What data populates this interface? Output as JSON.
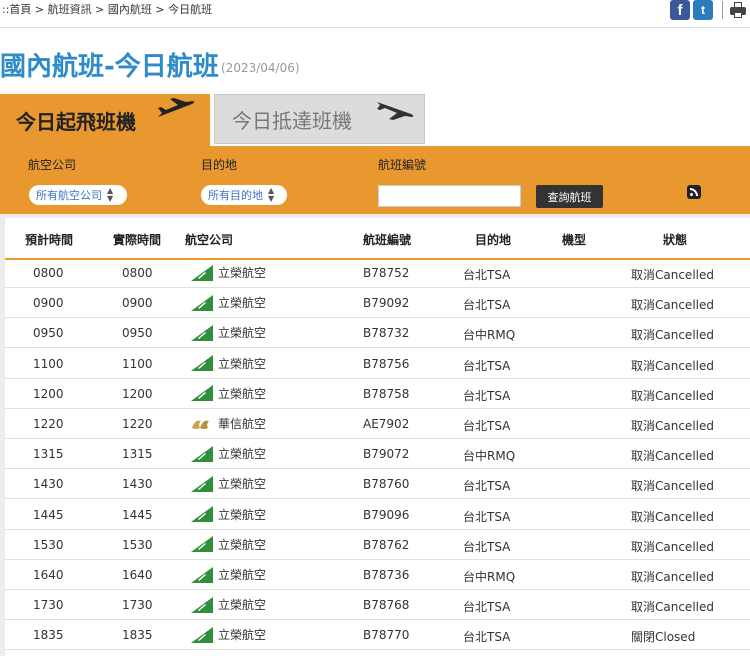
{
  "breadcrumb": {
    "prefix": "::",
    "items": [
      "首頁",
      "航班資訊",
      "國內航班",
      "今日航班"
    ],
    "separator": " > "
  },
  "social": {
    "facebook": "f",
    "twitter": "t"
  },
  "page": {
    "title": "國內航班-今日航班",
    "date": "(2023/04/06)"
  },
  "tabs": {
    "departures": "今日起飛班機",
    "arrivals": "今日抵達班機"
  },
  "filters": {
    "airline_label": "航空公司",
    "airline_value": "所有航空公司",
    "destination_label": "目的地",
    "destination_value": "所有目的地",
    "flight_no_label": "航班編號",
    "flight_no_value": "",
    "search_button": "查詢航班"
  },
  "table": {
    "headers": [
      "預計時間",
      "實際時間",
      "航空公司",
      "航班編號",
      "目的地",
      "機型",
      "狀態"
    ],
    "rows": [
      {
        "scheduled": "0800",
        "actual": "0800",
        "airline": "立榮航空",
        "logo": "uni",
        "flight": "B78752",
        "destination": "台北TSA",
        "aircraft": "",
        "status": "取消Cancelled"
      },
      {
        "scheduled": "0900",
        "actual": "0900",
        "airline": "立榮航空",
        "logo": "uni",
        "flight": "B79092",
        "destination": "台北TSA",
        "aircraft": "",
        "status": "取消Cancelled"
      },
      {
        "scheduled": "0950",
        "actual": "0950",
        "airline": "立榮航空",
        "logo": "uni",
        "flight": "B78732",
        "destination": "台中RMQ",
        "aircraft": "",
        "status": "取消Cancelled"
      },
      {
        "scheduled": "1100",
        "actual": "1100",
        "airline": "立榮航空",
        "logo": "uni",
        "flight": "B78756",
        "destination": "台北TSA",
        "aircraft": "",
        "status": "取消Cancelled"
      },
      {
        "scheduled": "1200",
        "actual": "1200",
        "airline": "立榮航空",
        "logo": "uni",
        "flight": "B78758",
        "destination": "台北TSA",
        "aircraft": "",
        "status": "取消Cancelled"
      },
      {
        "scheduled": "1220",
        "actual": "1220",
        "airline": "華信航空",
        "logo": "mandarin",
        "flight": "AE7902",
        "destination": "台北TSA",
        "aircraft": "",
        "status": "取消Cancelled"
      },
      {
        "scheduled": "1315",
        "actual": "1315",
        "airline": "立榮航空",
        "logo": "uni",
        "flight": "B79072",
        "destination": "台中RMQ",
        "aircraft": "",
        "status": "取消Cancelled"
      },
      {
        "scheduled": "1430",
        "actual": "1430",
        "airline": "立榮航空",
        "logo": "uni",
        "flight": "B78760",
        "destination": "台北TSA",
        "aircraft": "",
        "status": "取消Cancelled"
      },
      {
        "scheduled": "1445",
        "actual": "1445",
        "airline": "立榮航空",
        "logo": "uni",
        "flight": "B79096",
        "destination": "台北TSA",
        "aircraft": "",
        "status": "取消Cancelled"
      },
      {
        "scheduled": "1530",
        "actual": "1530",
        "airline": "立榮航空",
        "logo": "uni",
        "flight": "B78762",
        "destination": "台北TSA",
        "aircraft": "",
        "status": "取消Cancelled"
      },
      {
        "scheduled": "1640",
        "actual": "1640",
        "airline": "立榮航空",
        "logo": "uni",
        "flight": "B78736",
        "destination": "台中RMQ",
        "aircraft": "",
        "status": "取消Cancelled"
      },
      {
        "scheduled": "1730",
        "actual": "1730",
        "airline": "立榮航空",
        "logo": "uni",
        "flight": "B78768",
        "destination": "台北TSA",
        "aircraft": "",
        "status": "取消Cancelled"
      },
      {
        "scheduled": "1835",
        "actual": "1835",
        "airline": "立榮航空",
        "logo": "uni",
        "flight": "B78770",
        "destination": "台北TSA",
        "aircraft": "",
        "status": "關閉Closed"
      }
    ]
  },
  "colors": {
    "accent": "#e8982f",
    "title": "#2e8bc9",
    "uni_green": "#2f8f3a",
    "mandarin_gold": "#c9a24a"
  }
}
